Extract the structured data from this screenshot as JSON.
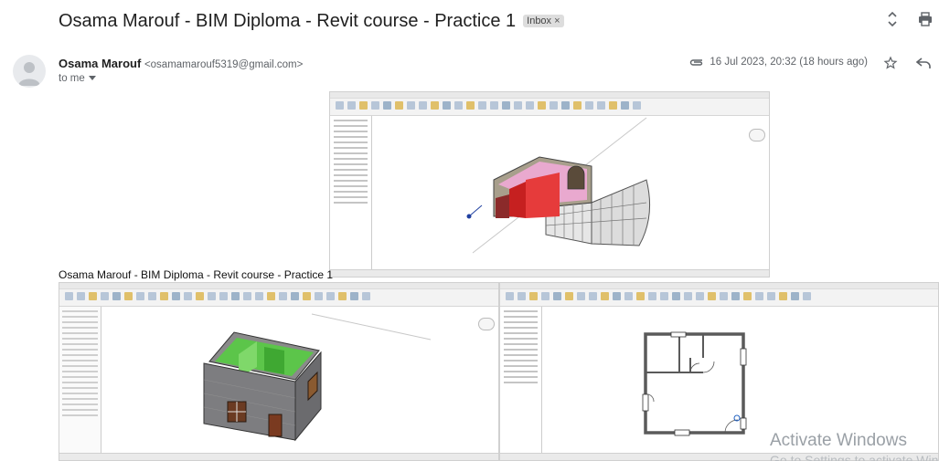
{
  "email": {
    "subject": "Osama Marouf - BIM Diploma - Revit course - Practice 1",
    "label": "Inbox",
    "label_close": "×",
    "sender_name": "Osama Marouf",
    "sender_email": "<osamamarouf5319@gmail.com>",
    "to": "to me",
    "date": "16 Jul 2023, 20:32 (18 hours ago)"
  },
  "attachments": {
    "caption": "Osama Marouf - BIM Diploma - Revit course - Practice  1"
  },
  "os_overlay": {
    "activation_title": "Activate Windows",
    "activation_sub": "Go to Settings to activate Windows."
  },
  "icons": {
    "expand": "unfold-icon",
    "print": "print-icon",
    "attachment": "paperclip-icon",
    "star": "star-icon",
    "reply": "reply-icon",
    "avatar": "person-icon"
  }
}
